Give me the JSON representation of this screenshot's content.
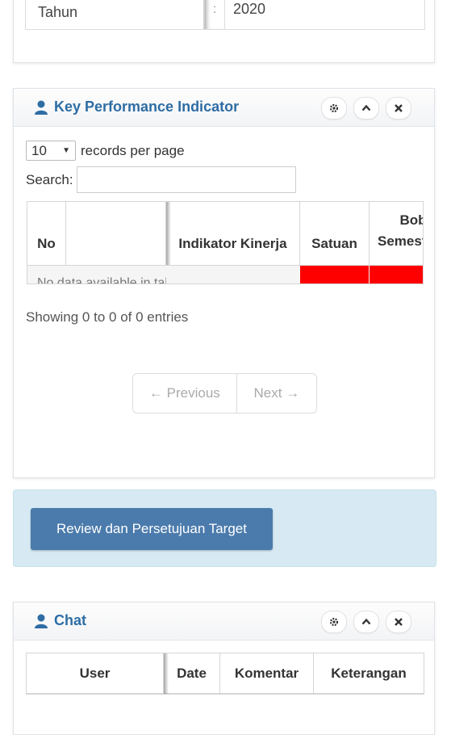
{
  "identity": {
    "tahun_label": "Tahun",
    "separator": ":",
    "tahun_value": "2020"
  },
  "kpi": {
    "title": "Key Performance Indicator",
    "page_size": "10",
    "records_per_page_label": "records per page",
    "search_label": "Search:",
    "search_value": "",
    "columns": [
      "No",
      "",
      "Indikator Kinerja",
      "Satuan",
      "Bobot Semester"
    ],
    "no_data": "No data available in table",
    "showing": "Showing 0 to 0 of 0 entries",
    "pager": {
      "previous": "← Previous",
      "next": "Next →"
    },
    "accent_red": "#ff0000"
  },
  "review": {
    "button_label": "Review dan Persetujuan Target",
    "bg": "#d7eaf3",
    "button_color": "#4b7bac"
  },
  "chat": {
    "title": "Chat",
    "columns": [
      "User",
      "Date",
      "Komentar",
      "Keterangan"
    ]
  },
  "panel_controls": [
    "gear-icon",
    "chevron-up-icon",
    "close-icon"
  ]
}
